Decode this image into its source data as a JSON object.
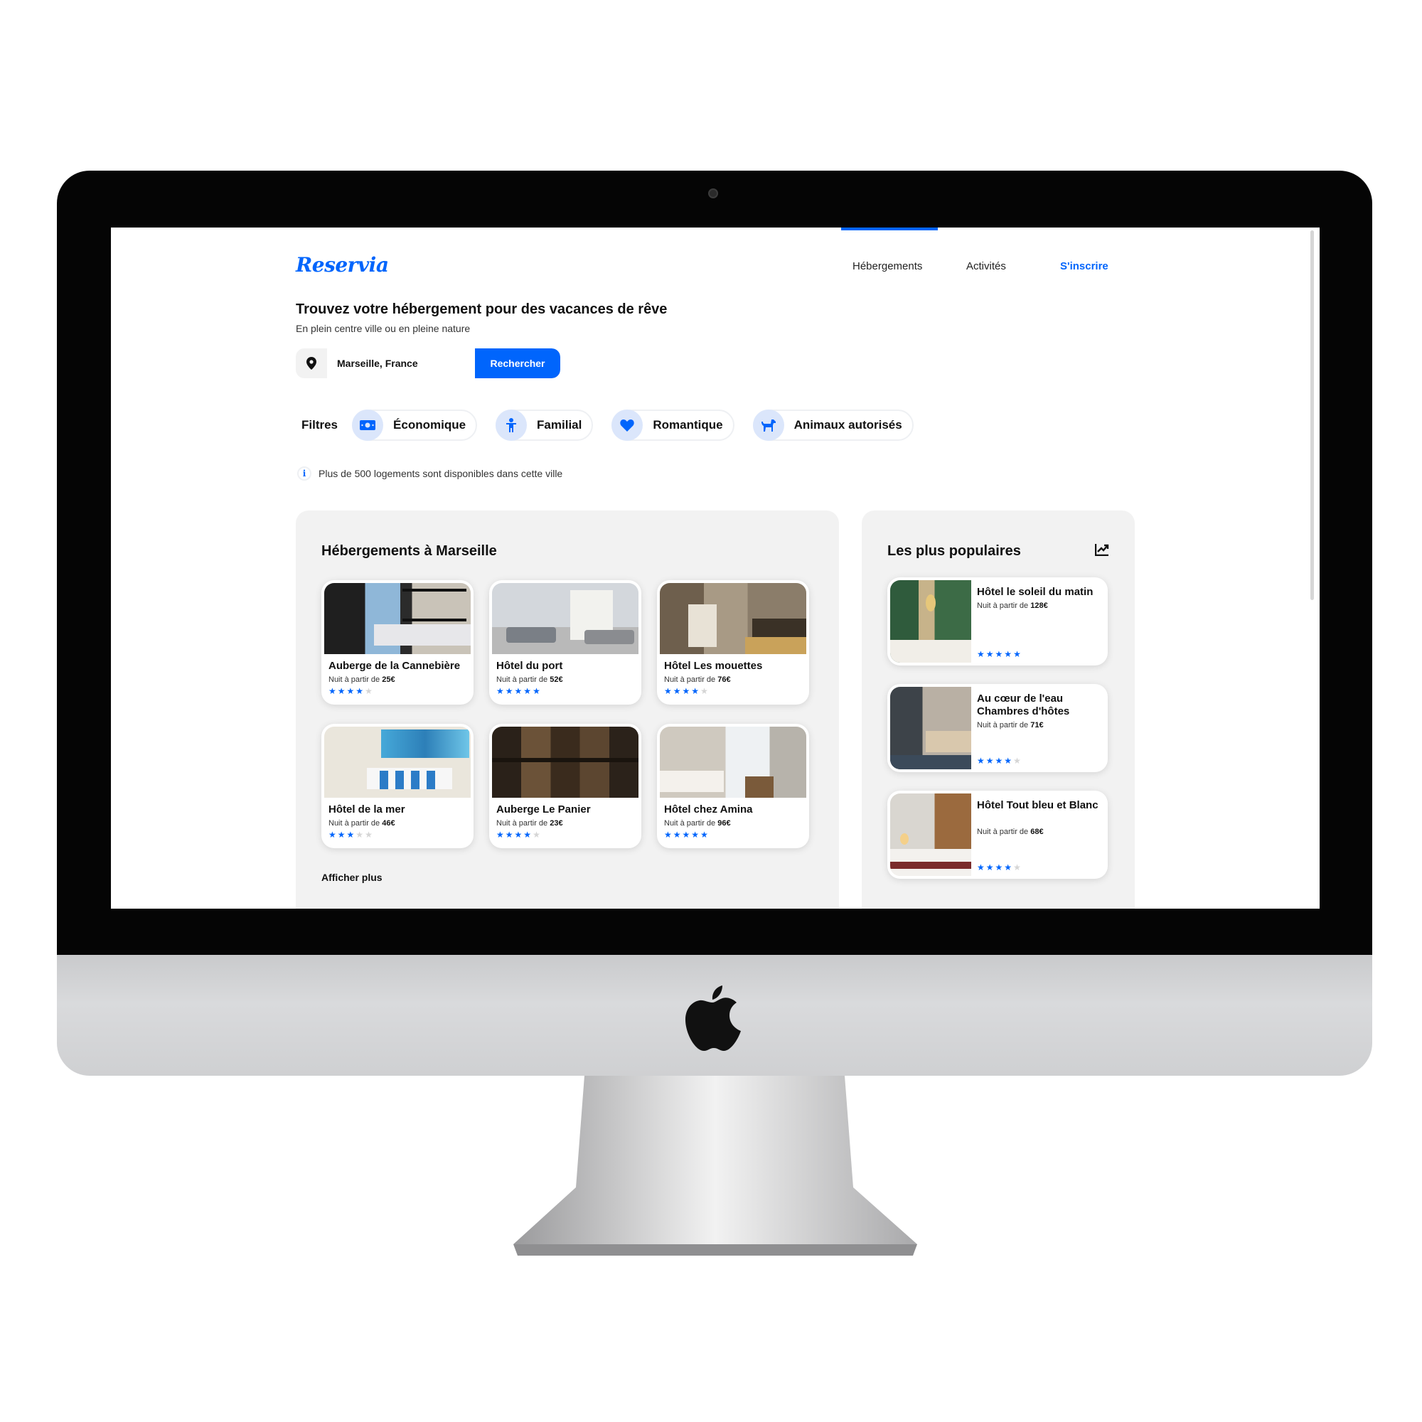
{
  "app": {
    "logo": "Reservia"
  },
  "nav": {
    "items": [
      {
        "label": "Hébergements",
        "active": true
      },
      {
        "label": "Activités"
      },
      {
        "label": "S'inscrire"
      }
    ],
    "accent": "#0065fc"
  },
  "hero": {
    "title": "Trouvez votre hébergement pour des vacances de rêve",
    "subtitle": "En plein centre ville ou en pleine nature"
  },
  "search": {
    "value": "Marseille, France",
    "button_label": "Rechercher"
  },
  "filters": {
    "label": "Filtres",
    "items": [
      {
        "label": "Économique",
        "icon": "money-icon"
      },
      {
        "label": "Familial",
        "icon": "child-icon"
      },
      {
        "label": "Romantique",
        "icon": "heart-icon"
      },
      {
        "label": "Animaux autorisés",
        "icon": "dog-icon"
      }
    ]
  },
  "info": {
    "text": "Plus de 500 logements sont disponibles dans cette ville"
  },
  "listings": {
    "title": "Hébergements à Marseille",
    "price_prefix": "Nuit à partir de",
    "items": [
      {
        "name": "Auberge de la Cannebière",
        "price": "25€",
        "rating": 4
      },
      {
        "name": "Hôtel du port",
        "price": "52€",
        "rating": 5
      },
      {
        "name": "Hôtel Les mouettes",
        "price": "76€",
        "rating": 4
      },
      {
        "name": "Hôtel de la mer",
        "price": "46€",
        "rating": 3
      },
      {
        "name": "Auberge Le Panier",
        "price": "23€",
        "rating": 4
      },
      {
        "name": "Hôtel chez Amina",
        "price": "96€",
        "rating": 5
      }
    ],
    "more_label": "Afficher plus"
  },
  "popular": {
    "title": "Les plus populaires",
    "icon": "trending-chart-icon",
    "price_prefix": "Nuit à partir de",
    "items": [
      {
        "name": "Hôtel le soleil du matin",
        "price": "128€",
        "rating": 5
      },
      {
        "name": "Au cœur de l'eau Chambres d'hôtes",
        "price": "71€",
        "rating": 4
      },
      {
        "name": "Hôtel Tout bleu et Blanc",
        "price": "68€",
        "rating": 4
      }
    ]
  }
}
